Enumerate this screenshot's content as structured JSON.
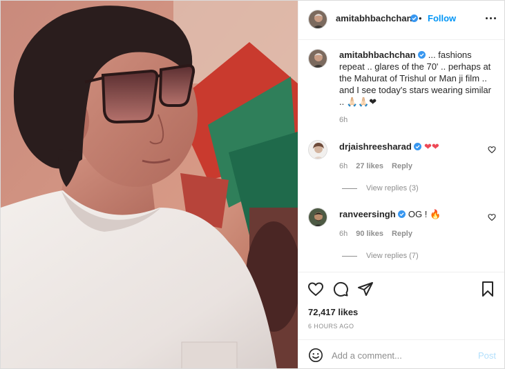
{
  "post": {
    "author": "amitabhbachchan",
    "follow_label": "Follow",
    "separator": "•",
    "photo_alt": "Vintage photo of a man in a white shirt wearing large tinted glasses"
  },
  "caption": {
    "username": "amitabhbachchan",
    "text": "... fashions repeat .. glares of the 70' .. perhaps at the Mahurat of Trishul or Man ji film .. and I see today's stars wearing similar .. 🙏🏻🙏🏻❤",
    "time": "6h"
  },
  "comments": [
    {
      "username": "drjaishreesharad",
      "text": "❤❤",
      "time": "6h",
      "likes": "27 likes",
      "reply_label": "Reply",
      "view_replies": "View replies (3)"
    },
    {
      "username": "ranveersingh",
      "text": "OG ! 🔥",
      "time": "6h",
      "likes": "90 likes",
      "reply_label": "Reply",
      "view_replies": "View replies (7)"
    }
  ],
  "stats": {
    "likes": "72,417 likes",
    "age": "6 HOURS AGO"
  },
  "composer": {
    "placeholder": "Add a comment...",
    "post_label": "Post"
  },
  "icons": {
    "like": "heart-outline-icon",
    "comment": "speech-bubble-icon",
    "share": "paper-plane-icon",
    "save": "bookmark-icon",
    "emoji": "smiley-icon",
    "more": "more-options-icon",
    "verified": "verified-badge-icon"
  },
  "colors": {
    "accent": "#0095f6",
    "verified": "#3897f0",
    "muted": "#8e8e8e",
    "post_disabled": "#b2dffc",
    "heart": "#ed4956"
  }
}
